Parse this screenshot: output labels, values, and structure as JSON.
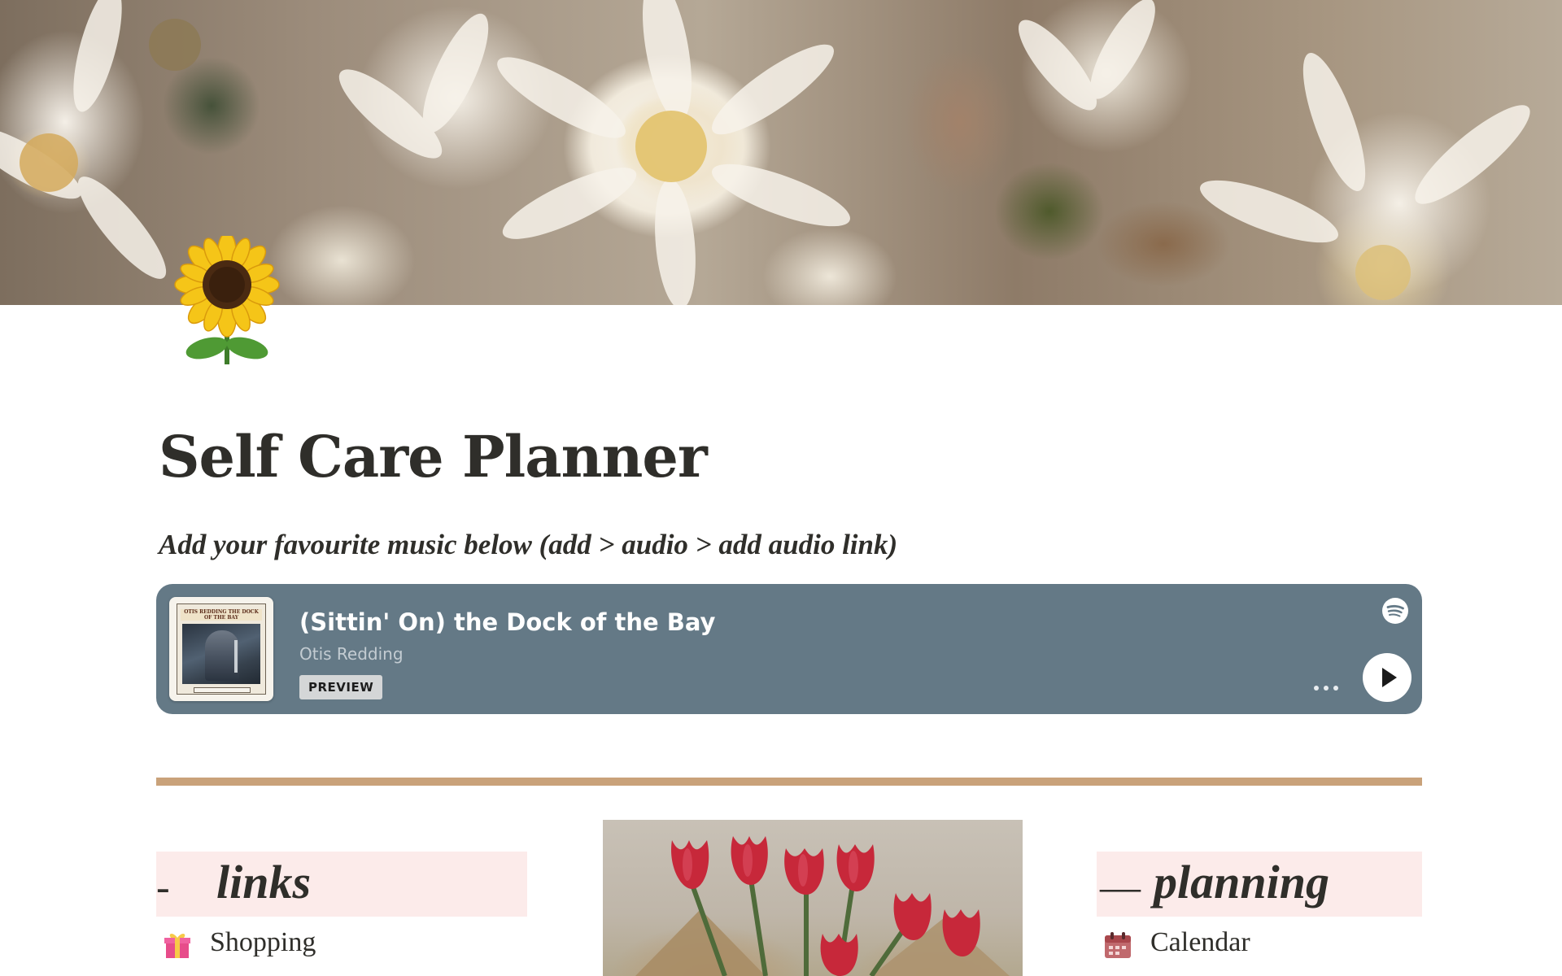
{
  "page": {
    "title": "Self Care Planner",
    "subtitle": "Add your favourite music below (add > audio > add audio link)"
  },
  "cover": {
    "icon": "sunflower-icon"
  },
  "audio_embed": {
    "track_title": "(Sittin' On) the Dock of the Bay",
    "artist": "Otis Redding",
    "badge": "PREVIEW",
    "album_caption": "OTIS REDDING THE DOCK OF THE BAY",
    "background_color": "#647986",
    "icons": [
      "spotify-logo-icon",
      "more-options-icon",
      "play-icon"
    ]
  },
  "divider": {
    "color": "#c9a27a"
  },
  "columns": {
    "links": {
      "dash": "-",
      "label": "links",
      "items": [
        {
          "icon": "gift-icon",
          "label": "Shopping"
        }
      ]
    },
    "planning": {
      "dash": "—",
      "label": "planning",
      "items": [
        {
          "icon": "calendar-icon",
          "label": "Calendar"
        }
      ]
    }
  },
  "colors": {
    "header_highlight": "#fcebea",
    "text": "#2f2e2a"
  }
}
